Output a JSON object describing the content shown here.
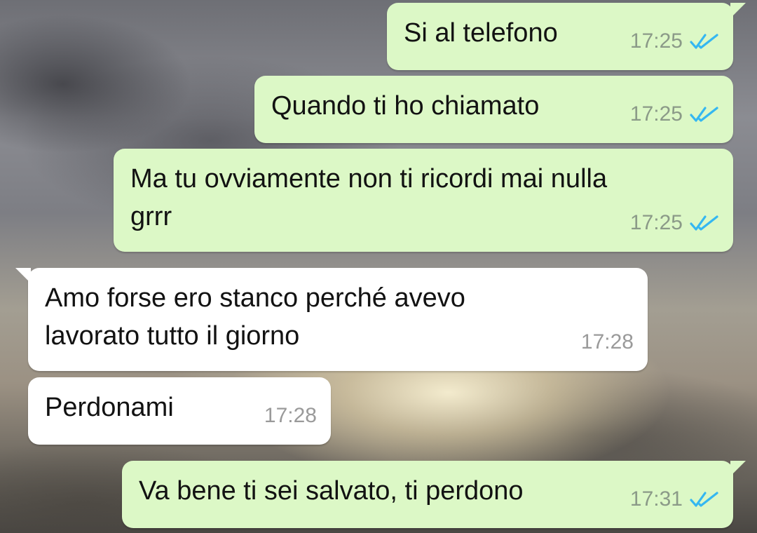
{
  "messages": [
    {
      "text": "Si al telefono",
      "time": "17:25",
      "direction": "outgoing",
      "status": "read"
    },
    {
      "text": "Quando ti ho chiamato",
      "time": "17:25",
      "direction": "outgoing",
      "status": "read"
    },
    {
      "text": "Ma tu ovviamente non ti ricordi mai nulla\ngrrr",
      "time": "17:25",
      "direction": "outgoing",
      "status": "read"
    },
    {
      "text": "Amo forse ero stanco perché avevo\nlavorato tutto il giorno",
      "time": "17:28",
      "direction": "incoming"
    },
    {
      "text": "Perdonami",
      "time": "17:28",
      "direction": "incoming"
    },
    {
      "text": "Va bene ti sei salvato, ti perdono",
      "time": "17:31",
      "direction": "outgoing",
      "status": "read"
    }
  ],
  "colors": {
    "outgoing_bubble": "#dcf8c6",
    "incoming_bubble": "#ffffff",
    "read_ticks": "#34b7f1"
  },
  "icons": {
    "read_status": "double-check-icon"
  }
}
